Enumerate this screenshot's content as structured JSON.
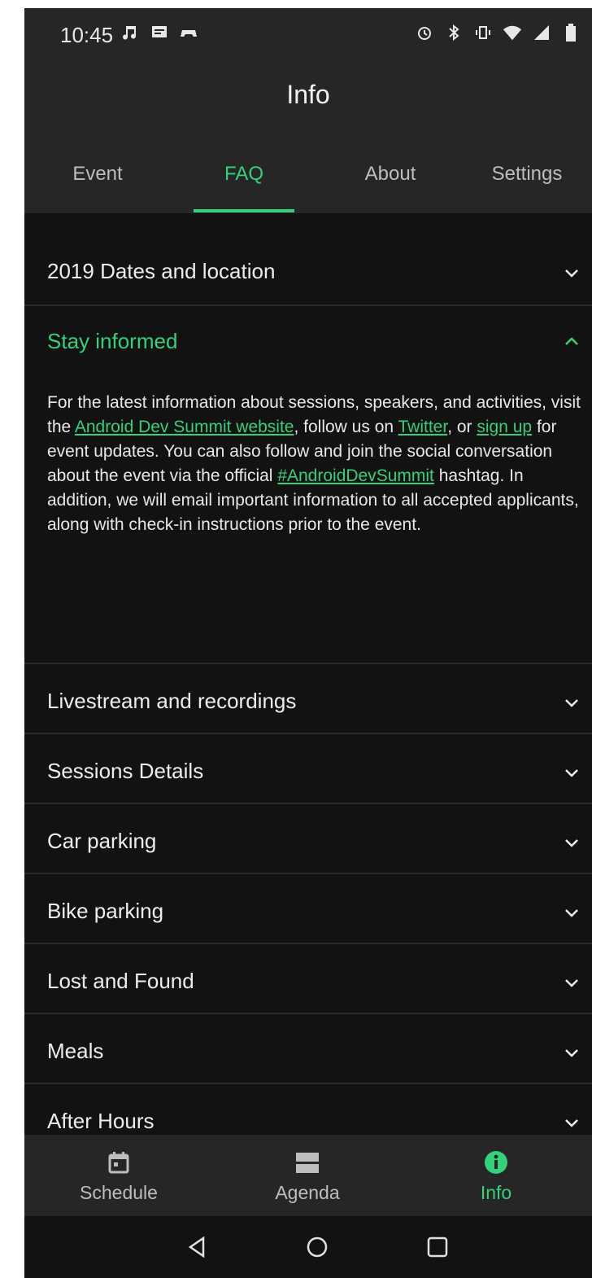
{
  "status": {
    "time": "10:45",
    "left_icons": [
      "music-icon",
      "message-icon",
      "game-icon"
    ],
    "right_icons": [
      "alarm-icon",
      "bluetooth-icon",
      "vibrate-icon",
      "wifi-icon",
      "signal-icon",
      "battery-icon"
    ]
  },
  "header": {
    "title": "Info"
  },
  "tabs": [
    {
      "label": "Event",
      "active": false
    },
    {
      "label": "FAQ",
      "active": true
    },
    {
      "label": "About",
      "active": false
    },
    {
      "label": "Settings",
      "active": false
    }
  ],
  "faq": {
    "items": [
      {
        "label": "2019 Dates and location",
        "expanded": false
      },
      {
        "label": "Stay informed",
        "expanded": true
      },
      {
        "label": "Livestream and recordings",
        "expanded": false
      },
      {
        "label": "Sessions Details",
        "expanded": false
      },
      {
        "label": "Car parking",
        "expanded": false
      },
      {
        "label": "Bike parking",
        "expanded": false
      },
      {
        "label": "Lost and Found",
        "expanded": false
      },
      {
        "label": "Meals",
        "expanded": false
      },
      {
        "label": "After Hours",
        "expanded": false
      }
    ],
    "stay_informed_body": {
      "t1": "For the latest information about sessions, speakers, and activities, visit the ",
      "link1": "Android Dev Summit website",
      "t2": ", follow us on ",
      "link2": "Twitter",
      "t3": ", or ",
      "link3": "sign up",
      "t4": " for event updates. You can also follow and join the social conversation about the event via the official ",
      "link4": "#AndroidDevSummit",
      "t5": " hashtag. In addition, we will email important information to all accepted applicants, along with check-in instructions prior to the event."
    }
  },
  "bottom_nav": [
    {
      "label": "Schedule",
      "icon": "calendar-icon",
      "active": false
    },
    {
      "label": "Agenda",
      "icon": "agenda-icon",
      "active": false
    },
    {
      "label": "Info",
      "icon": "info-icon",
      "active": true
    }
  ],
  "system_nav": [
    "back-icon",
    "home-icon",
    "recents-icon"
  ],
  "colors": {
    "accent": "#34d17a",
    "background": "#121212",
    "surface": "#262626",
    "text_primary": "#ededed",
    "text_secondary": "#bdbdbd"
  }
}
